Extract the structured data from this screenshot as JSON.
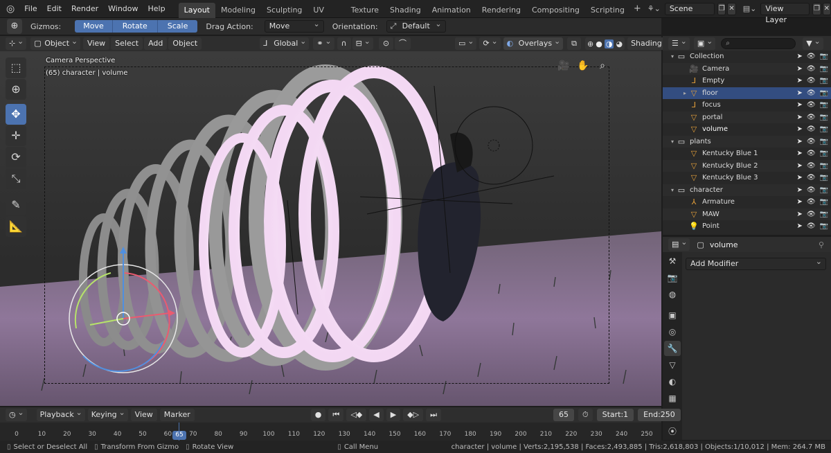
{
  "topbar": {
    "menus": [
      "File",
      "Edit",
      "Render",
      "Window",
      "Help"
    ],
    "workspaces": [
      "Layout",
      "Modeling",
      "Sculpting",
      "UV Editing",
      "Texture Paint",
      "Shading",
      "Animation",
      "Rendering",
      "Compositing",
      "Scripting"
    ],
    "active_workspace": "Layout",
    "scene": "Scene",
    "view_layer": "View Layer"
  },
  "toolheader": {
    "gizmos_label": "Gizmos:",
    "gizmo_buttons": [
      "Move",
      "Rotate",
      "Scale"
    ],
    "drag_action_label": "Drag Action:",
    "drag_action_value": "Move",
    "orientation_label": "Orientation:",
    "orientation_value": "Default"
  },
  "viewport_header": {
    "mode": "Object Mode",
    "menus": [
      "View",
      "Select",
      "Add",
      "Object"
    ],
    "transform_orientation": "Global",
    "overlays_label": "Overlays",
    "shading_label": "Shading"
  },
  "viewport": {
    "camera_label": "Camera Perspective",
    "object_label": "(65) character | volume"
  },
  "outliner": {
    "rows": [
      {
        "name": "Collection",
        "icon": "collection-icon",
        "indent": 0,
        "expand": "▾"
      },
      {
        "name": "Camera",
        "icon": "camera-icon",
        "indent": 1
      },
      {
        "name": "Empty",
        "icon": "empty-icon",
        "indent": 1
      },
      {
        "name": "floor",
        "icon": "mesh-icon",
        "indent": 1,
        "selected": true,
        "expand": "▸"
      },
      {
        "name": "focus",
        "icon": "empty-icon",
        "indent": 1
      },
      {
        "name": "portal",
        "icon": "mesh-icon",
        "indent": 1
      },
      {
        "name": "volume",
        "icon": "mesh-icon",
        "indent": 1,
        "active": true
      },
      {
        "name": "plants",
        "icon": "collection-icon",
        "indent": 0,
        "expand": "▾"
      },
      {
        "name": "Kentucky Blue 1",
        "icon": "mesh-icon",
        "indent": 1
      },
      {
        "name": "Kentucky Blue 2",
        "icon": "mesh-icon",
        "indent": 1
      },
      {
        "name": "Kentucky Blue 3",
        "icon": "mesh-icon",
        "indent": 1
      },
      {
        "name": "character",
        "icon": "collection-icon",
        "indent": 0,
        "expand": "▾"
      },
      {
        "name": "Armature",
        "icon": "armature-icon",
        "indent": 1
      },
      {
        "name": "MAW",
        "icon": "mesh-icon",
        "indent": 1
      },
      {
        "name": "Point",
        "icon": "light-icon",
        "indent": 1
      }
    ]
  },
  "properties": {
    "object_name": "volume",
    "add_modifier_label": "Add Modifier"
  },
  "timeline": {
    "menus": [
      "Playback",
      "Keying",
      "View",
      "Marker"
    ],
    "current_frame": "65",
    "start_label": "Start:",
    "start_value": "1",
    "end_label": "End:",
    "end_value": "250",
    "ticks": [
      "0",
      "10",
      "20",
      "30",
      "40",
      "50",
      "60",
      "70",
      "80",
      "90",
      "100",
      "110",
      "120",
      "130",
      "140",
      "150",
      "160",
      "170",
      "180",
      "190",
      "200",
      "210",
      "220",
      "230",
      "240",
      "250"
    ]
  },
  "statusbar": {
    "hint1": "Select or Deselect All",
    "hint2": "Transform From Gizmo",
    "hint3": "Rotate View",
    "hint4": "Call Menu",
    "stats": "character | volume | Verts:2,195,538 | Faces:2,493,885 | Tris:2,618,803 | Objects:1/10,012 | Mem: 264.7 MB"
  },
  "colors": {
    "accent": "#4c73b0",
    "selected_row": "#334d80"
  }
}
